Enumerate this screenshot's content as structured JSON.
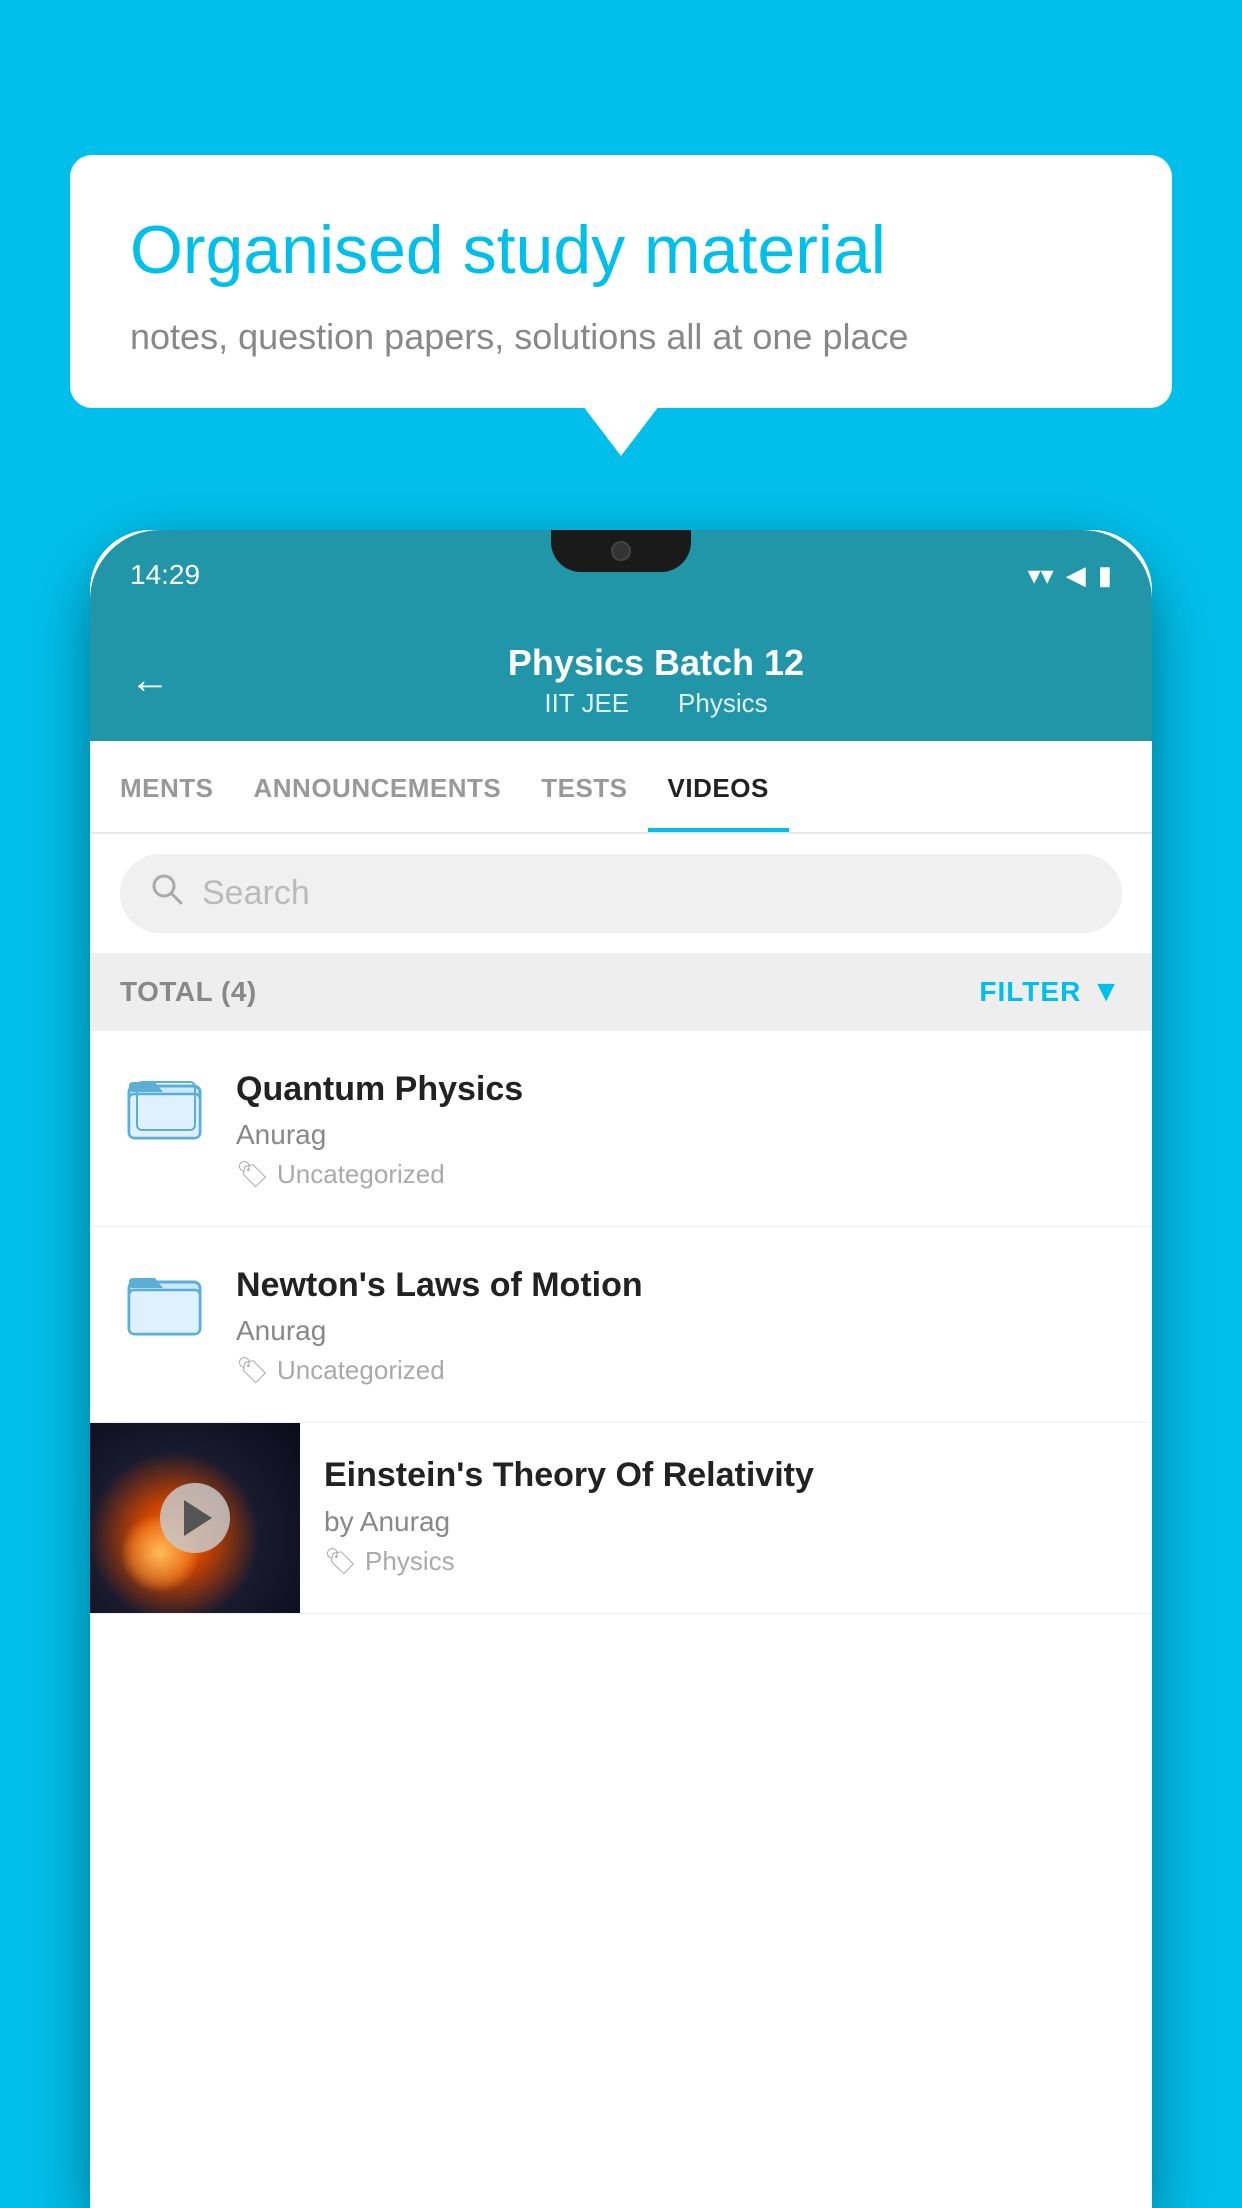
{
  "background_color": "#00BFEA",
  "speech_bubble": {
    "headline": "Organised study material",
    "subtext": "notes, question papers, solutions all at one place"
  },
  "phone": {
    "status_bar": {
      "time": "14:29",
      "wifi": "▼",
      "signal": "◄",
      "battery": "▮"
    },
    "header": {
      "title": "Physics Batch 12",
      "subtitle1": "IIT JEE",
      "subtitle2": "Physics",
      "back_label": "←"
    },
    "tabs": [
      {
        "label": "MENTS",
        "active": false
      },
      {
        "label": "ANNOUNCEMENTS",
        "active": false
      },
      {
        "label": "TESTS",
        "active": false
      },
      {
        "label": "VIDEOS",
        "active": true
      }
    ],
    "search": {
      "placeholder": "Search"
    },
    "filter_bar": {
      "total_label": "TOTAL (4)",
      "filter_label": "FILTER"
    },
    "videos": [
      {
        "title": "Quantum Physics",
        "author": "Anurag",
        "tag": "Uncategorized",
        "type": "folder"
      },
      {
        "title": "Newton's Laws of Motion",
        "author": "Anurag",
        "tag": "Uncategorized",
        "type": "folder"
      },
      {
        "title": "Einstein's Theory Of Relativity",
        "author": "by Anurag",
        "tag": "Physics",
        "type": "video"
      }
    ]
  }
}
